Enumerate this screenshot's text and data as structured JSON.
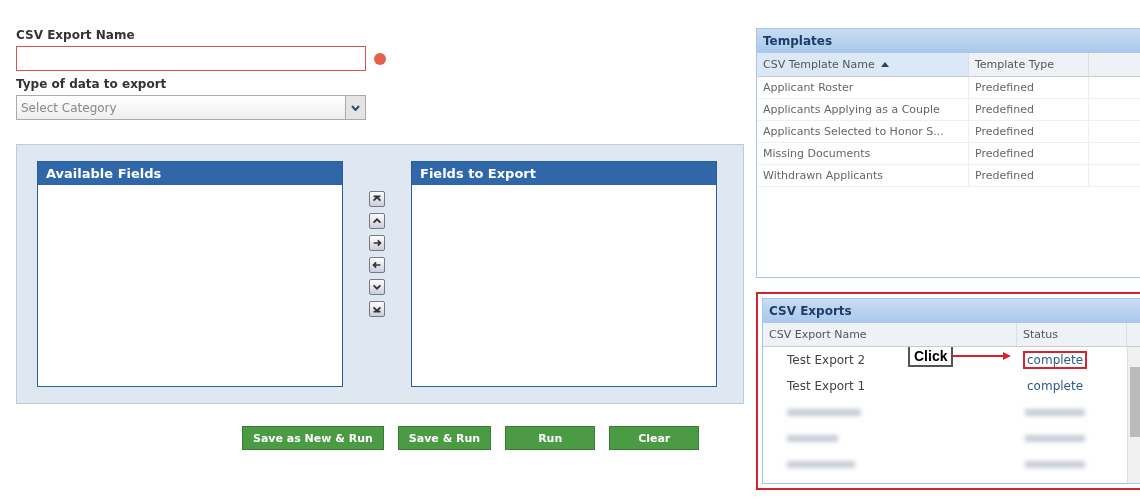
{
  "form": {
    "name_label": "CSV Export Name",
    "name_error": true,
    "type_label": "Type of data to export",
    "type_placeholder": "Select Category"
  },
  "available_fields": {
    "title": "Available Fields"
  },
  "export_fields": {
    "title": "Fields to Export"
  },
  "move_buttons": [
    {
      "kind": "top"
    },
    {
      "kind": "up"
    },
    {
      "kind": "right"
    },
    {
      "kind": "left"
    },
    {
      "kind": "down"
    },
    {
      "kind": "bottom"
    }
  ],
  "actions": [
    "Save as New & Run",
    "Save & Run",
    "Run",
    "Clear"
  ],
  "templates": {
    "title": "Templates",
    "columns": [
      {
        "label": "CSV Template Name",
        "sorted": true
      },
      {
        "label": "Template Type",
        "sorted": false
      }
    ],
    "rows": [
      [
        "Applicant Roster",
        "Predefined"
      ],
      [
        "Applicants Applying as a Couple",
        "Predefined"
      ],
      [
        "Applicants Selected to Honor S...",
        "Predefined"
      ],
      [
        "Missing Documents",
        "Predefined"
      ],
      [
        "Withdrawn Applicants",
        "Predefined"
      ]
    ]
  },
  "exports": {
    "title": "CSV Exports",
    "highlighted_panel": true,
    "columns": [
      "CSV Export Name",
      "Status"
    ],
    "rows": [
      {
        "kind": "row",
        "name": "Test Export 2",
        "status": "complete",
        "highlighted": true
      },
      {
        "kind": "row",
        "name": "Test Export 1",
        "status": "complete",
        "highlighted": false
      },
      {
        "kind": "redacted"
      },
      {
        "kind": "redacted"
      },
      {
        "kind": "redacted"
      }
    ],
    "callout": "Click"
  }
}
